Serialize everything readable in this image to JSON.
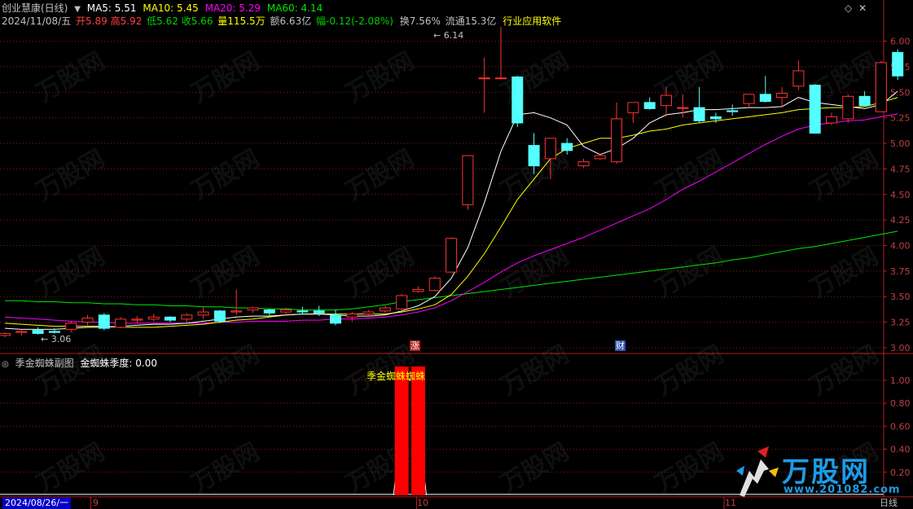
{
  "header": {
    "stock_name": "创业慧康(日线)",
    "ma5": "MA5: 5.51",
    "ma10": "MA10: 5.45",
    "ma20": "MA20: 5.29",
    "ma60": "MA60: 4.14",
    "date": "2024/11/08/五",
    "open": "开5.89",
    "high": "高5.92",
    "low": "低5.62",
    "close": "收5.66",
    "volume": "量115.5万",
    "amount": "额6.63亿",
    "change": "幅-0.12(-2.08%)",
    "turnover": "换7.56%",
    "float": "流通15.3亿",
    "industry": "行业应用软件"
  },
  "sub_header": {
    "title": "季金蜘蛛副图",
    "value": "金蜘蛛季度: 0.00",
    "signal_label": "季金蜘蛛蜘蛛"
  },
  "markers": {
    "zhang": "涨",
    "cai": "财"
  },
  "annotations": {
    "high_label": "6.14",
    "low_label": "3.06"
  },
  "footer": {
    "date_box": "2024/08/26/一",
    "months": [
      "9",
      "10",
      "11"
    ],
    "period": "日线"
  },
  "watermark": {
    "text": "万股网",
    "url": "www.201082.com"
  },
  "logo": {
    "text": "万股网",
    "url": "www.201082.com"
  },
  "colors": {
    "up": "#ff3232",
    "down": "#54ffff",
    "ma5": "#ffffff",
    "ma10": "#ffff00",
    "ma20": "#ff00ff",
    "ma60": "#00e600",
    "grid": "#8b1a1a",
    "axis": "#b02020"
  },
  "chart_data": [
    {
      "type": "candlestick",
      "y_ticks": [
        3.0,
        3.25,
        3.5,
        3.75,
        4.0,
        4.25,
        4.5,
        4.75,
        5.0,
        5.25,
        5.5,
        5.75,
        6.0
      ],
      "ylim": [
        2.96,
        6.14
      ],
      "ohlc": [
        [
          3.12,
          3.15,
          3.1,
          3.14
        ],
        [
          3.15,
          3.18,
          3.12,
          3.16
        ],
        [
          3.17,
          3.2,
          3.13,
          3.14
        ],
        [
          3.16,
          3.19,
          3.14,
          3.15
        ],
        [
          3.18,
          3.26,
          3.15,
          3.24
        ],
        [
          3.25,
          3.32,
          3.22,
          3.29
        ],
        [
          3.32,
          3.34,
          3.17,
          3.19
        ],
        [
          3.2,
          3.3,
          3.19,
          3.28
        ],
        [
          3.27,
          3.31,
          3.24,
          3.28
        ],
        [
          3.28,
          3.33,
          3.26,
          3.3
        ],
        [
          3.3,
          3.31,
          3.25,
          3.27
        ],
        [
          3.28,
          3.34,
          3.25,
          3.32
        ],
        [
          3.32,
          3.4,
          3.28,
          3.35
        ],
        [
          3.36,
          3.37,
          3.24,
          3.26
        ],
        [
          3.35,
          3.57,
          3.32,
          3.36
        ],
        [
          3.37,
          3.4,
          3.34,
          3.39
        ],
        [
          3.37,
          3.38,
          3.3,
          3.34
        ],
        [
          3.35,
          3.39,
          3.31,
          3.37
        ],
        [
          3.36,
          3.4,
          3.33,
          3.35
        ],
        [
          3.36,
          3.41,
          3.31,
          3.34
        ],
        [
          3.32,
          3.37,
          3.22,
          3.24
        ],
        [
          3.3,
          3.35,
          3.26,
          3.33
        ],
        [
          3.33,
          3.37,
          3.31,
          3.35
        ],
        [
          3.36,
          3.41,
          3.34,
          3.39
        ],
        [
          3.38,
          3.53,
          3.37,
          3.51
        ],
        [
          3.55,
          3.6,
          3.54,
          3.57
        ],
        [
          3.56,
          3.7,
          3.55,
          3.68
        ],
        [
          3.74,
          4.08,
          3.74,
          4.07
        ],
        [
          4.4,
          4.88,
          4.35,
          4.88
        ],
        [
          5.64,
          5.84,
          5.3,
          5.64
        ],
        [
          5.64,
          6.14,
          5.64,
          5.64
        ],
        [
          5.65,
          5.66,
          5.16,
          5.2
        ],
        [
          4.98,
          5.1,
          4.7,
          4.78
        ],
        [
          4.85,
          5.05,
          4.65,
          5.05
        ],
        [
          5.0,
          5.05,
          4.89,
          4.93
        ],
        [
          4.78,
          4.85,
          4.76,
          4.82
        ],
        [
          4.85,
          4.9,
          4.84,
          4.88
        ],
        [
          4.82,
          5.4,
          4.8,
          5.24
        ],
        [
          5.3,
          5.4,
          5.2,
          5.4
        ],
        [
          5.4,
          5.45,
          5.33,
          5.34
        ],
        [
          5.37,
          5.55,
          5.26,
          5.47
        ],
        [
          5.35,
          5.48,
          5.25,
          5.35
        ],
        [
          5.35,
          5.55,
          5.2,
          5.22
        ],
        [
          5.26,
          5.3,
          5.2,
          5.24
        ],
        [
          5.32,
          5.38,
          5.27,
          5.31
        ],
        [
          5.39,
          5.48,
          5.36,
          5.48
        ],
        [
          5.48,
          5.66,
          5.4,
          5.41
        ],
        [
          5.45,
          5.55,
          5.35,
          5.49
        ],
        [
          5.56,
          5.81,
          5.52,
          5.71
        ],
        [
          5.57,
          5.58,
          5.1,
          5.1
        ],
        [
          5.2,
          5.3,
          5.18,
          5.26
        ],
        [
          5.24,
          5.48,
          5.2,
          5.46
        ],
        [
          5.46,
          5.51,
          5.37,
          5.37
        ],
        [
          5.31,
          5.81,
          5.31,
          5.79
        ],
        [
          5.89,
          5.92,
          5.62,
          5.66
        ]
      ],
      "ma5": [
        3.19,
        3.18,
        3.18,
        3.18,
        3.19,
        3.2,
        3.2,
        3.21,
        3.22,
        3.23,
        3.23,
        3.24,
        3.26,
        3.28,
        3.3,
        3.31,
        3.31,
        3.32,
        3.33,
        3.33,
        3.32,
        3.31,
        3.31,
        3.32,
        3.36,
        3.41,
        3.5,
        3.68,
        3.98,
        4.42,
        4.92,
        5.28,
        5.3,
        5.25,
        5.18,
        4.97,
        4.89,
        4.95,
        5.05,
        5.2,
        5.28,
        5.3,
        5.33,
        5.33,
        5.34,
        5.35,
        5.35,
        5.36,
        5.45,
        5.4,
        5.38,
        5.36,
        5.34,
        5.38,
        5.51
      ],
      "ma10": [
        3.24,
        3.23,
        3.22,
        3.21,
        3.21,
        3.21,
        3.21,
        3.2,
        3.2,
        3.2,
        3.21,
        3.22,
        3.23,
        3.25,
        3.27,
        3.28,
        3.3,
        3.32,
        3.33,
        3.33,
        3.33,
        3.33,
        3.33,
        3.33,
        3.35,
        3.38,
        3.42,
        3.52,
        3.7,
        3.92,
        4.18,
        4.45,
        4.65,
        4.85,
        4.95,
        5.0,
        5.05,
        5.05,
        5.08,
        5.12,
        5.14,
        5.18,
        5.2,
        5.22,
        5.24,
        5.26,
        5.28,
        5.3,
        5.33,
        5.34,
        5.35,
        5.35,
        5.36,
        5.4,
        5.45
      ],
      "ma20": [
        3.3,
        3.29,
        3.28,
        3.27,
        3.26,
        3.25,
        3.25,
        3.24,
        3.24,
        3.24,
        3.24,
        3.24,
        3.24,
        3.25,
        3.25,
        3.26,
        3.26,
        3.26,
        3.27,
        3.27,
        3.28,
        3.28,
        3.29,
        3.3,
        3.32,
        3.35,
        3.39,
        3.46,
        3.55,
        3.64,
        3.74,
        3.83,
        3.9,
        3.96,
        4.02,
        4.08,
        4.15,
        4.22,
        4.29,
        4.36,
        4.45,
        4.55,
        4.63,
        4.72,
        4.81,
        4.9,
        4.99,
        5.07,
        5.14,
        5.18,
        5.2,
        5.22,
        5.23,
        5.26,
        5.29
      ],
      "ma60": [
        3.46,
        3.46,
        3.45,
        3.45,
        3.44,
        3.44,
        3.43,
        3.43,
        3.42,
        3.42,
        3.41,
        3.41,
        3.4,
        3.4,
        3.39,
        3.39,
        3.38,
        3.38,
        3.37,
        3.37,
        3.37,
        3.38,
        3.4,
        3.42,
        3.45,
        3.47,
        3.49,
        3.51,
        3.53,
        3.55,
        3.57,
        3.59,
        3.61,
        3.63,
        3.65,
        3.67,
        3.69,
        3.71,
        3.73,
        3.75,
        3.77,
        3.79,
        3.81,
        3.83,
        3.86,
        3.88,
        3.91,
        3.94,
        3.97,
        3.99,
        4.02,
        4.05,
        4.08,
        4.11,
        4.14
      ]
    },
    {
      "type": "bar",
      "name": "季金蜘蛛",
      "y_ticks": [
        0.2,
        0.4,
        0.6,
        0.8,
        1.0
      ],
      "ylim": [
        0,
        1.12
      ],
      "bars": [
        {
          "index": 24,
          "value": 1.12
        },
        {
          "index": 25,
          "value": 1.12
        }
      ],
      "outline": [
        [
          23.5,
          0
        ],
        [
          24,
          0.6
        ],
        [
          24,
          1.0
        ],
        [
          25,
          1.0
        ],
        [
          25,
          0.6
        ],
        [
          25.5,
          0
        ]
      ]
    }
  ]
}
